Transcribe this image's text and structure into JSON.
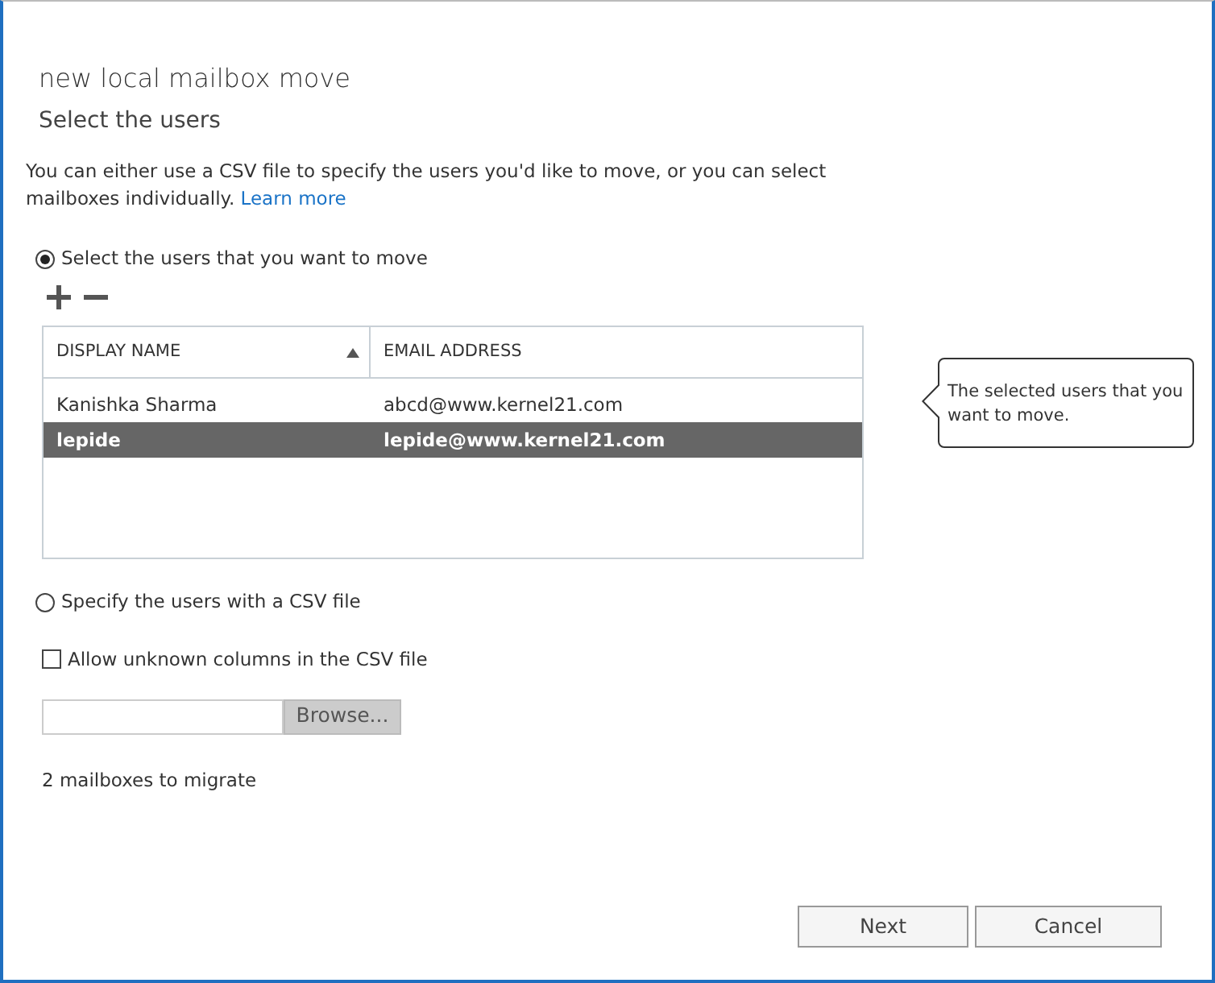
{
  "title": "new local mailbox move",
  "subtitle": "Select the users",
  "intro": "You can either use a CSV file to specify the users you'd like to move, or you can select mailboxes individually.",
  "learn_more": "Learn more",
  "options": [
    {
      "label": "Select the users that you want to move",
      "selected": true
    },
    {
      "label": "Specify the users with a CSV file",
      "selected": false
    }
  ],
  "table": {
    "columns": [
      {
        "label": "DISPLAY NAME",
        "sorted": true
      },
      {
        "label": "EMAIL ADDRESS",
        "sorted": false
      }
    ],
    "rows": [
      {
        "cells": [
          "Kanishka Sharma",
          "abcd@www.kernel21.com"
        ],
        "selected": false
      },
      {
        "cells": [
          "lepide",
          "lepide@www.kernel21.com"
        ],
        "selected": true
      }
    ]
  },
  "tooltip": "The selected users that you want to move.",
  "allow_unknown": {
    "label": "Allow unknown columns in the CSV file",
    "checked": false
  },
  "browse_button": "Browse...",
  "count": "2 mailboxes to migrate",
  "buttons": [
    "Next",
    "Cancel"
  ]
}
